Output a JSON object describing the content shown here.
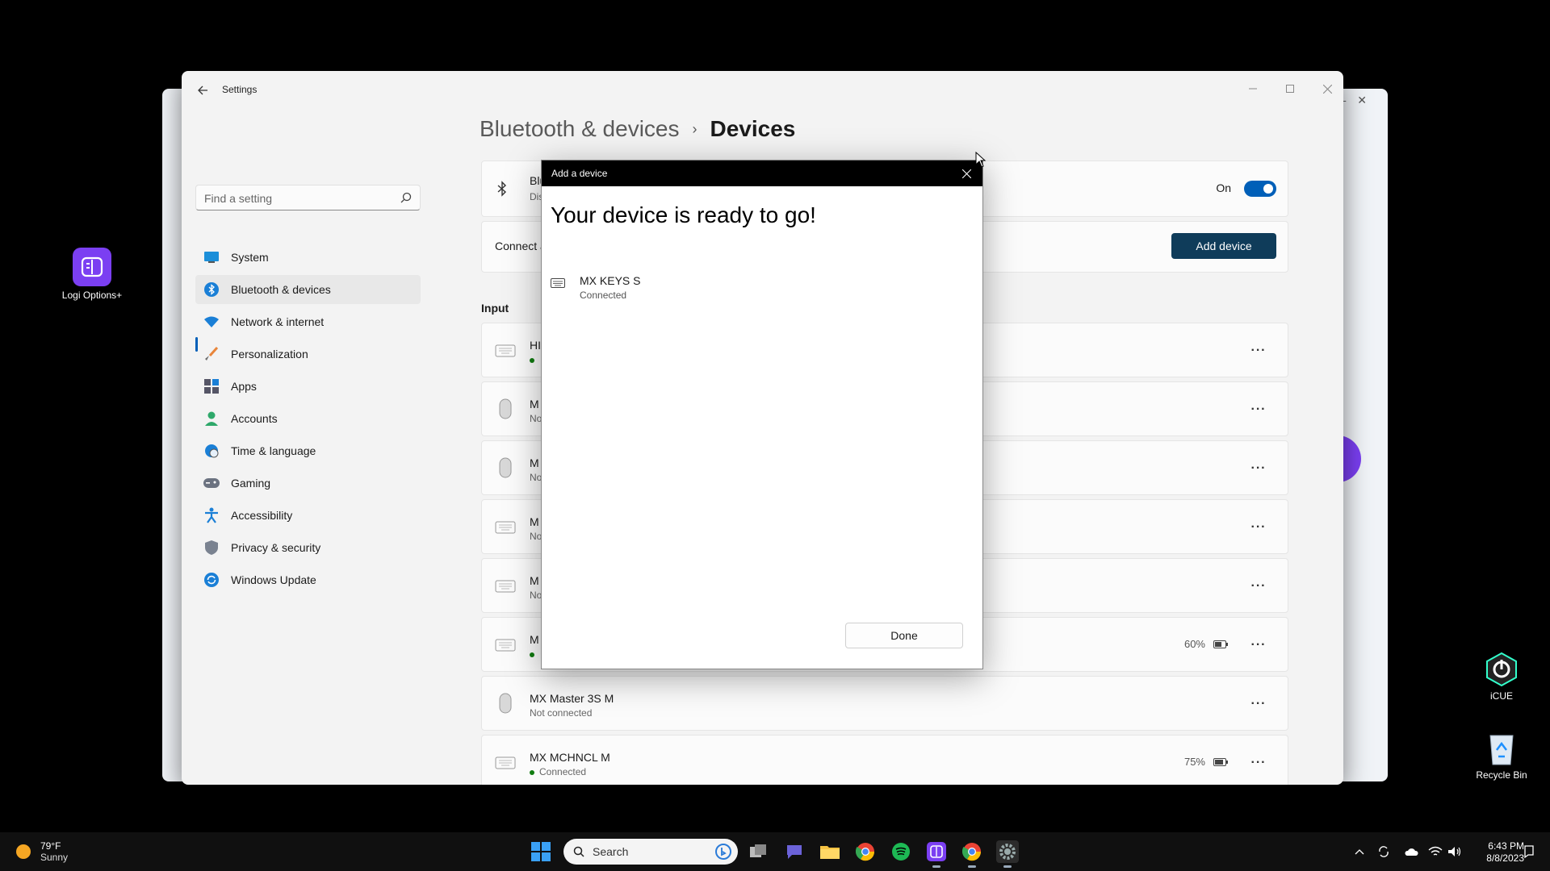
{
  "desktop": {
    "logi_label": "Logi Options+",
    "icue_label": "iCUE",
    "recycle_label": "Recycle Bin"
  },
  "window": {
    "title": "Settings",
    "accent": "#005fb8"
  },
  "sidebar": {
    "search_placeholder": "Find a setting",
    "items": [
      {
        "label": "System",
        "icon": "monitor-icon"
      },
      {
        "label": "Bluetooth & devices",
        "icon": "bluetooth-icon",
        "active": true
      },
      {
        "label": "Network & internet",
        "icon": "wifi-icon"
      },
      {
        "label": "Personalization",
        "icon": "brush-icon"
      },
      {
        "label": "Apps",
        "icon": "apps-icon"
      },
      {
        "label": "Accounts",
        "icon": "account-icon"
      },
      {
        "label": "Time & language",
        "icon": "globe-clock-icon"
      },
      {
        "label": "Gaming",
        "icon": "gamepad-icon"
      },
      {
        "label": "Accessibility",
        "icon": "accessibility-icon"
      },
      {
        "label": "Privacy & security",
        "icon": "shield-icon"
      },
      {
        "label": "Windows Update",
        "icon": "update-icon"
      }
    ]
  },
  "breadcrumb": {
    "parent": "Bluetooth & devices",
    "separator": "›",
    "current": "Devices"
  },
  "bluetooth_card": {
    "title_visible": "Blu",
    "sub_visible": "Dis",
    "toggle_label": "On",
    "toggle_on": true
  },
  "connect_card": {
    "title_visible": "Connect a",
    "button_label": "Add device"
  },
  "input_section": {
    "heading": "Input",
    "devices": [
      {
        "name_visible": "HI",
        "status_visible": "",
        "dot": true,
        "icon": "keyboard-icon",
        "battery": ""
      },
      {
        "name_visible": "M",
        "status_visible": "No",
        "icon": "mouse-icon",
        "battery": ""
      },
      {
        "name_visible": "M",
        "status_visible": "No",
        "icon": "mouse-icon",
        "battery": ""
      },
      {
        "name_visible": "M",
        "status_visible": "No",
        "icon": "keyboard-icon",
        "battery": ""
      },
      {
        "name_visible": "M",
        "status_visible": "No",
        "icon": "keyboard-icon",
        "battery": ""
      },
      {
        "name_visible": "M",
        "status_visible": "",
        "dot": true,
        "icon": "keyboard-icon",
        "battery": "60%"
      },
      {
        "name_visible": "MX Master 3S M",
        "status_visible": "Not connected",
        "icon": "mouse-icon",
        "battery": ""
      },
      {
        "name_visible": "MX MCHNCL M",
        "status_visible": "Connected",
        "dot": true,
        "icon": "keyboard-icon",
        "battery": "75%"
      }
    ]
  },
  "dialog": {
    "title": "Add a device",
    "heading": "Your device is ready to go!",
    "device_name": "MX KEYS S",
    "device_status": "Connected",
    "done_label": "Done"
  },
  "taskbar": {
    "weather_temp": "79°F",
    "weather_cond": "Sunny",
    "search_label": "Search",
    "time": "6:43 PM",
    "date": "8/8/2023"
  }
}
